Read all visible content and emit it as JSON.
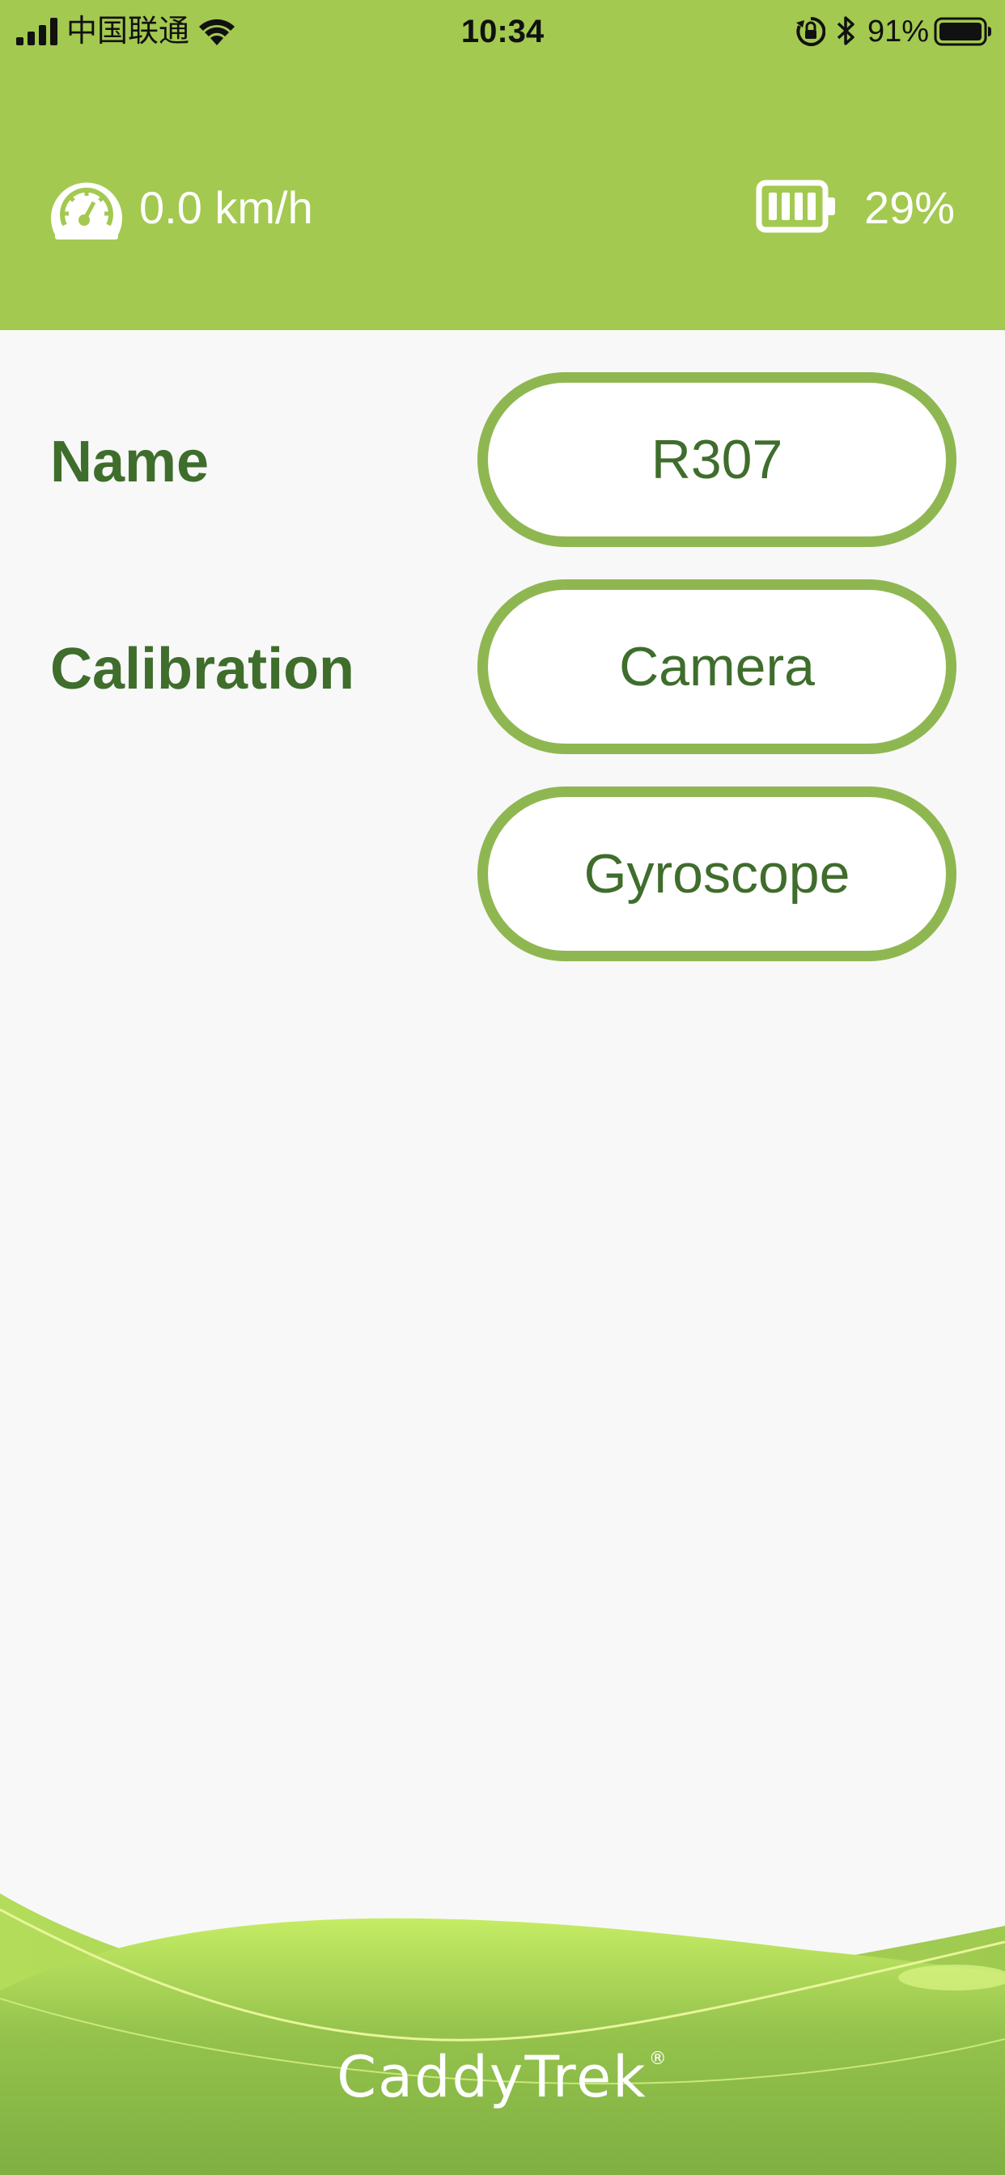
{
  "status_bar": {
    "carrier": "中国联通",
    "time": "10:34",
    "battery_percent": "91%"
  },
  "header": {
    "speed": "0.0 km/h",
    "cart_battery": "29%",
    "background_color": "#a3c950",
    "icons": [
      "speedometer-icon",
      "battery-icon"
    ]
  },
  "settings": {
    "name_label": "Name",
    "name_value": "R307",
    "calibration_label": "Calibration",
    "camera_button": "Camera",
    "gyroscope_button": "Gyroscope"
  },
  "footer": {
    "logo": "CaddyTrek",
    "registered_mark": "®"
  },
  "colors": {
    "accent": "#8fb751",
    "text_green": "#3f6d2c",
    "background": "#f8f8f8"
  }
}
